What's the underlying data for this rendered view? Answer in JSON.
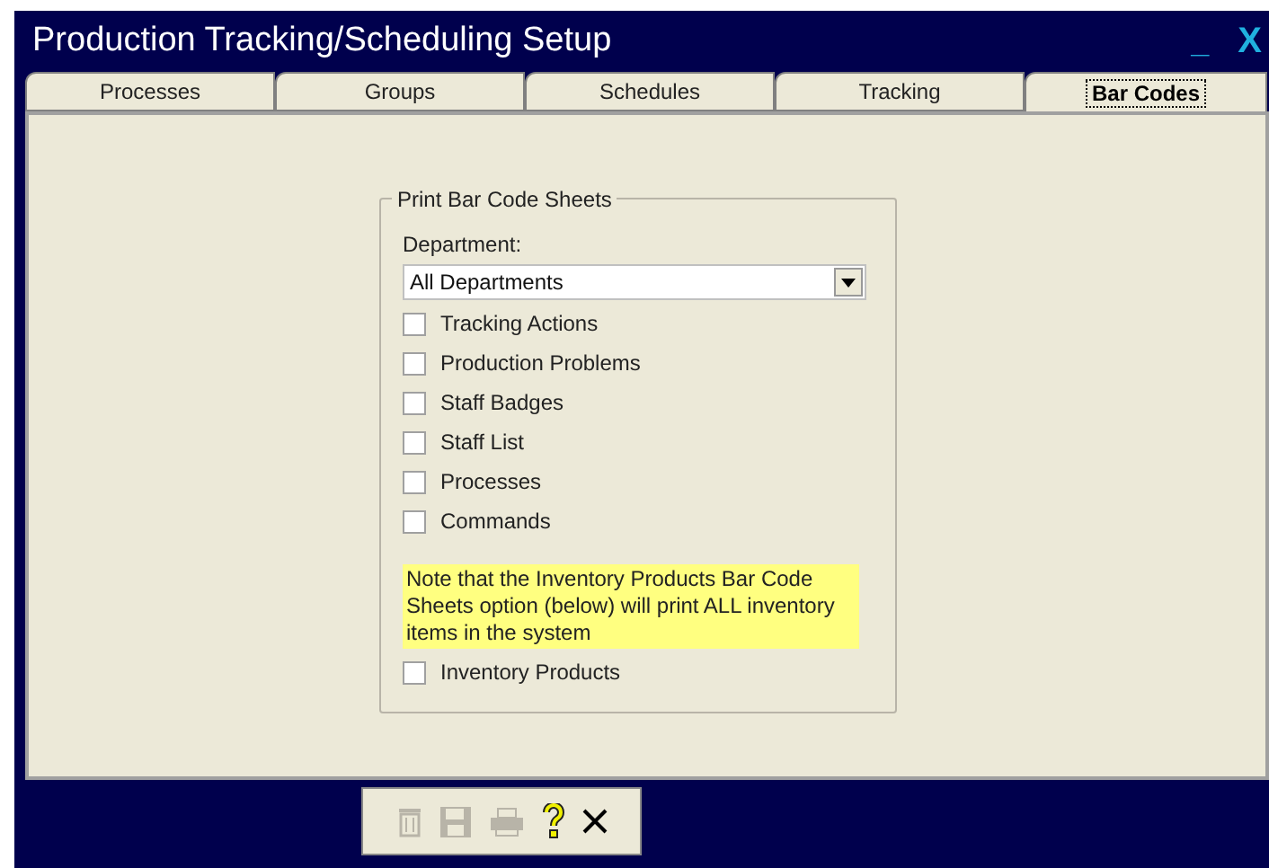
{
  "window": {
    "title": "Production Tracking/Scheduling Setup",
    "minimize": "_",
    "close": "X"
  },
  "tabs": [
    {
      "label": "Processes",
      "selected": false
    },
    {
      "label": "Groups",
      "selected": false
    },
    {
      "label": "Schedules",
      "selected": false
    },
    {
      "label": "Tracking",
      "selected": false
    },
    {
      "label": "Bar Codes",
      "selected": true
    }
  ],
  "group": {
    "title": "Print Bar Code Sheets",
    "department_label": "Department:",
    "department_value": "All Departments",
    "options": [
      {
        "label": "Tracking Actions",
        "checked": false
      },
      {
        "label": "Production Problems",
        "checked": false
      },
      {
        "label": "Staff Badges",
        "checked": false
      },
      {
        "label": "Staff List",
        "checked": false
      },
      {
        "label": "Processes",
        "checked": false
      },
      {
        "label": "Commands",
        "checked": false
      }
    ],
    "note": "Note that the Inventory Products Bar Code Sheets option (below) will print ALL inventory items in the system",
    "inventory": {
      "label": "Inventory Products",
      "checked": false
    }
  },
  "toolbar": [
    {
      "kind": "trash",
      "disabled": true
    },
    {
      "kind": "save",
      "disabled": true
    },
    {
      "kind": "print",
      "disabled": true
    },
    {
      "kind": "help",
      "disabled": false
    },
    {
      "kind": "close",
      "disabled": false
    }
  ]
}
